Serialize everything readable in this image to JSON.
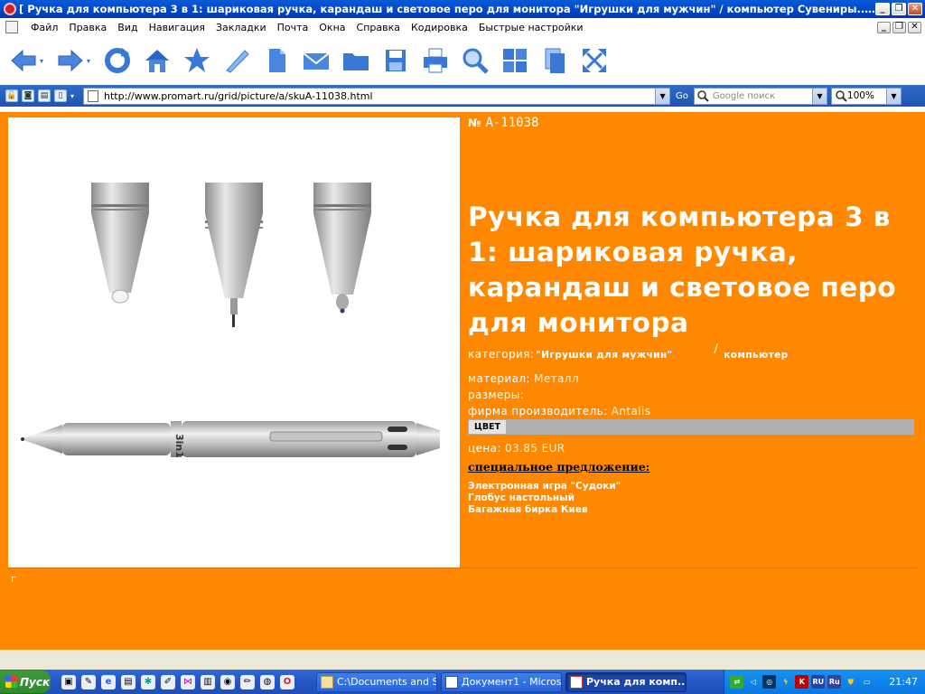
{
  "window": {
    "title": "[ Ручка для компьютера 3 в 1: шариковая ручка, карандаш и световое перо для монитора \"Игрушки для мужчин\" / компьютер Сувениры... ] - Opera"
  },
  "menu": {
    "items": [
      "Файл",
      "Правка",
      "Вид",
      "Навигация",
      "Закладки",
      "Почта",
      "Окна",
      "Справка",
      "Кодировка",
      "Быстрые настройки"
    ]
  },
  "toolbar": {
    "icons": [
      "back-arrow-icon",
      "forward-arrow-icon",
      "reload-icon",
      "home-icon",
      "star-icon",
      "pen-icon",
      "page-icon",
      "mail-icon",
      "folder-icon",
      "save-icon",
      "print-icon",
      "search-icon",
      "windows-icon",
      "copy-icon",
      "fullscreen-icon"
    ]
  },
  "address": {
    "url": "http://www.promart.ru/grid/picture/a/skuA-11038.html",
    "go_label": "Go",
    "search_placeholder": "Google поиск",
    "zoom": "100%"
  },
  "product": {
    "sku_symbol": "№",
    "sku": "A-11038",
    "title": "Ручка для компьютера 3 в 1: шариковая ручка, карандаш и световое перо для монитора",
    "category_label": "категория:",
    "category_link1": "\"Игрушки для мужчин\"",
    "category_sep": "/",
    "category_link2": "компьютер",
    "material_label": "материал:",
    "material_value": "Металл",
    "sizes_label": "размеры:",
    "manufacturer_label": "фирма производитель:",
    "manufacturer_value": "Antalis",
    "color_label": "ЦВЕТ",
    "price_label": "цена:",
    "price_value": "03.85 EUR",
    "special_heading": "специальное предложение:",
    "special_items": [
      "Электронная игра \"Судоки\"",
      "Глобус настольный",
      "Багажная бирка Киев"
    ],
    "footer_char": "г",
    "pen_brand_mark": "3in1"
  },
  "taskbar": {
    "start_label": "Пуск",
    "tasks": [
      {
        "label": "C:\\Documents and S...",
        "active": false
      },
      {
        "label": "Документ1 - Micros...",
        "active": false
      },
      {
        "label": "Ручка для комп...",
        "active": true
      }
    ],
    "tray_items": [
      "K",
      "RU",
      "Ru"
    ],
    "clock": "21:47"
  },
  "colors": {
    "page_bg": "#FF8800",
    "titlebar": "#0046C8",
    "color_bar": "#B0B0B0"
  }
}
